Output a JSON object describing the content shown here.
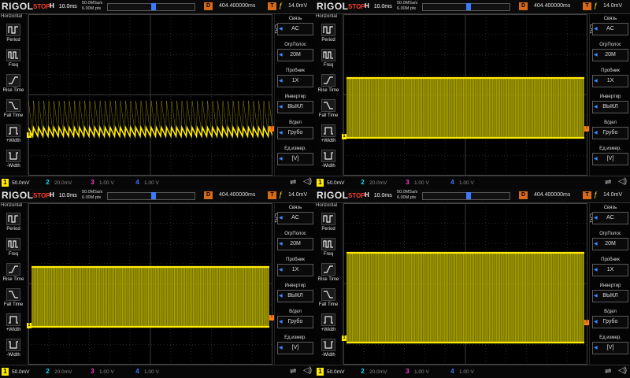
{
  "header": {
    "logo": "RIGOL",
    "status": "STOP",
    "h_label": "H",
    "timebase": "10.0ms",
    "sample_rate": "50.0MSa/s",
    "memory_depth": "6.00M pts",
    "delay_label": "D",
    "delay_value": "404.400000ms",
    "trigger_label": "T",
    "trigger_level": "14.0mV"
  },
  "left_menu": {
    "title": "Horizontal",
    "items": [
      {
        "label": "Period",
        "icon": "period-icon"
      },
      {
        "label": "Freq",
        "icon": "freq-icon"
      },
      {
        "label": "Rise Time",
        "icon": "rise-time-icon"
      },
      {
        "label": "Fall Time",
        "icon": "fall-time-icon"
      },
      {
        "label": "+Width",
        "icon": "pos-width-icon"
      },
      {
        "label": "-Width",
        "icon": "neg-width-icon"
      }
    ]
  },
  "right_menu": {
    "channel": "CH1",
    "items": [
      {
        "title": "Связь",
        "value": "AC"
      },
      {
        "title": "ОгрПолос",
        "value": "20M"
      },
      {
        "title": "Пробник",
        "value": "1X"
      },
      {
        "title": "Инвертир",
        "value": "ВЫКЛ"
      },
      {
        "title": "В/дел",
        "value": "Грубо"
      },
      {
        "title": "Ед.измер.",
        "value": "[V]"
      }
    ]
  },
  "channels": [
    {
      "num": "1",
      "scale": "50.0mV",
      "color": "#ffea00"
    },
    {
      "num": "2",
      "scale": "20.0mV",
      "color": "#00e5ff"
    },
    {
      "num": "3",
      "scale": "1.00 V",
      "color": "#ff3dd8"
    },
    {
      "num": "4",
      "scale": "1.00 V",
      "color": "#3b7bff"
    }
  ],
  "panels": [
    {
      "waveform": "sparse-sawtooth"
    },
    {
      "waveform": "dense-band"
    },
    {
      "waveform": "dense-band"
    },
    {
      "waveform": "dense-band-tall"
    }
  ],
  "colors": {
    "trace": "#ffea00",
    "grid": "#2a2a2a",
    "accent": "#d76b1a",
    "stop": "#ff3b2e"
  }
}
